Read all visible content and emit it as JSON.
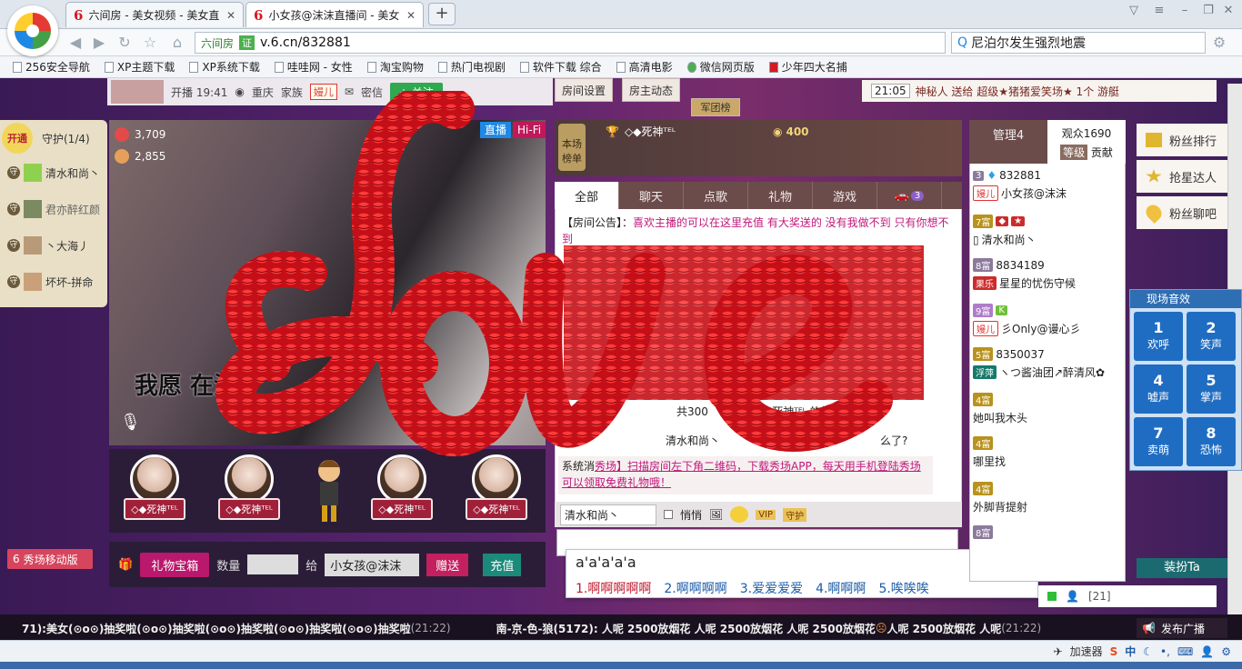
{
  "browser": {
    "tabs": [
      {
        "label": "六间房 - 美女视频 - 美女直"
      },
      {
        "label": "小女孩@沫沫直播间 - 美女"
      }
    ],
    "address": {
      "site": "六间房",
      "cert": "证",
      "url": "v.6.cn/832881"
    },
    "search": {
      "value": "尼泊尔发生强烈地震"
    },
    "bookmarks": [
      "256安全导航",
      "XP主题下载",
      "XP系统下载",
      "哇哇网 - 女性",
      "淘宝购物",
      "热门电视剧",
      "软件下载 综合",
      "高清电影",
      "微信网页版",
      "少年四大名捕"
    ]
  },
  "room": {
    "start_label": "开播 19:41",
    "location": "重庆",
    "family_label": "家族",
    "family_tag": "嫚儿",
    "dm_label": "密信",
    "follow_label": "+ 关注",
    "settings_label": "房间设置",
    "host_news_label": "房主动态",
    "army_label": "军团榜",
    "broadcast": {
      "time": "21:05",
      "text": "神秘人 送给 超级★猪猪爱笑场★ 1个 游艇"
    }
  },
  "guard": {
    "open_label": "开通",
    "title": "守护(1/4)",
    "members": [
      {
        "badge": "守",
        "name": "清水和尚丶"
      },
      {
        "badge": "守",
        "name": "君亦醉红颜"
      },
      {
        "badge": "守",
        "name": "丶大海丿"
      },
      {
        "badge": "守",
        "name": "坏坏-拼命"
      }
    ]
  },
  "video": {
    "wealth": "3,709",
    "popularity": "2,855",
    "live_label": "直播",
    "quality_label": "Hi-Fi",
    "subtitle": "我愿 在温"
  },
  "fans": [
    {
      "name": "◇◆死神ᵀᴱᴸ"
    },
    {
      "name": "◇◆死神ᵀᴱᴸ"
    },
    {
      "name": ""
    },
    {
      "name": "◇◆死神ᵀᴱᴸ"
    },
    {
      "name": "◇◆死神ᵀᴱᴸ"
    }
  ],
  "gift": {
    "box_label": "礼物宝箱",
    "qty_label": "数量",
    "to_label": "给",
    "recipient": "小女孩@沫沫",
    "send_label": "赠送",
    "charge_label": "充值"
  },
  "mobile_label": "秀场移动版",
  "chat": {
    "rank_label": "本场榜单",
    "top_user": "◇◆死神ᵀᴱᴸ",
    "top_score": "400",
    "tabs": [
      "全部",
      "聊天",
      "点歌",
      "礼物",
      "游戏",
      ""
    ],
    "car_count": "3",
    "notice_prefix": "【房间公告】：",
    "notice_text": "喜欢主播的可以在这里充值 有大奖送的 没有我做不到 只有你想不到",
    "line1": "共300",
    "line1b": "◆死神ᵀᴱᴸ 的热情支",
    "line2a": "清水和尚丶",
    "line2b": "么了?",
    "system_prefix": "系统消",
    "system_text": "秀场】扫描房间左下角二维码，下载秀场APP，每天用手机登陆秀场可以领取免费礼物哦！",
    "to_user": "清水和尚丶",
    "whisper_label": "悄悄",
    "vip_label": "VIP",
    "guard_btn": "守护",
    "ime_input": "a'a'a'a'a",
    "ime_candidates": [
      "1.啊啊啊啊啊",
      "2.啊啊啊啊",
      "3.爱爱爱爱",
      "4.啊啊啊",
      "5.唉唉唉"
    ]
  },
  "users": {
    "admin_tab": "管理4",
    "audience_tab": "观众1690",
    "rank_label": "等级",
    "contrib_label": "贡献",
    "list": [
      {
        "level": "3",
        "id": "832881",
        "tag": "嫚儿",
        "name": "小女孩@沫沫"
      },
      {
        "level": "7富",
        "id": "",
        "tag": "",
        "name": "清水和尚丶"
      },
      {
        "level": "8富",
        "id": "8834189",
        "tag": "果乐",
        "name": "星星的忧伤守候"
      },
      {
        "level": "9富",
        "id": "K",
        "tag": "嫚儿",
        "name": "彡Only@谩心彡"
      },
      {
        "level": "5富",
        "id": "8350037",
        "tag": "浮萍",
        "name": "ヽつ酱油团↗醉清风✿"
      },
      {
        "level": "4富",
        "id": "",
        "tag": "",
        "name": "她叫我木头"
      },
      {
        "level": "4富",
        "id": "",
        "tag": "",
        "name": "哪里找"
      },
      {
        "level": "4富",
        "id": "",
        "tag": "",
        "name": "外脚背提射"
      },
      {
        "level": "8富",
        "id": "",
        "tag": "",
        "name": ""
      }
    ]
  },
  "right_menu": [
    "粉丝排行",
    "抢星达人",
    "粉丝聊吧"
  ],
  "sfx": {
    "title": "现场音效",
    "buttons": [
      {
        "num": "1",
        "label": "欢呼"
      },
      {
        "num": "2",
        "label": "笑声"
      },
      {
        "num": "4",
        "label": "嘘声"
      },
      {
        "num": "5",
        "label": "掌声"
      },
      {
        "num": "7",
        "label": "卖萌"
      },
      {
        "num": "8",
        "label": "恐怖"
      }
    ]
  },
  "dress_label": "装扮Ta",
  "online_count": "[21]",
  "ticker": {
    "text1": "71):美女(⊙o⊙)抽奖啦(⊙o⊙)抽奖啦(⊙o⊙)抽奖啦(⊙o⊙)抽奖啦(⊙o⊙)抽奖啦",
    "time1": "(21:22)",
    "text2": "南-京-色-狼(5172): 人呢 2500放烟花 人呢 2500放烟花 人呢 2500放烟花 ",
    "text3": "人呢 2500放烟花 人呢",
    "time2": "(21:22)",
    "publish_label": "发布广播"
  },
  "status": {
    "accel_label": "加速器",
    "ime_mode": "中"
  },
  "colors": {
    "accent": "#c0177a",
    "love_red": "#d4141c",
    "brand_red": "#d71920"
  }
}
